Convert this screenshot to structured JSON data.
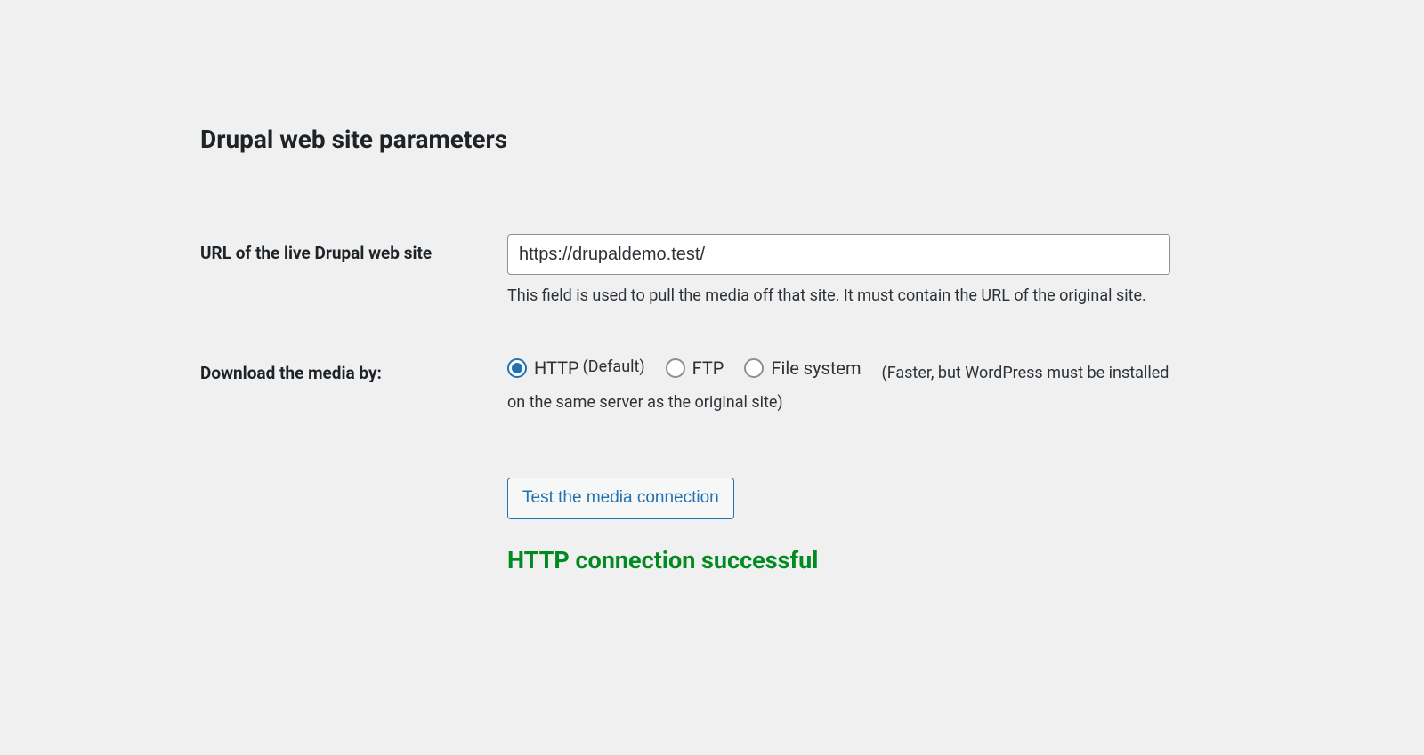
{
  "section": {
    "title": "Drupal web site parameters"
  },
  "url_field": {
    "label": "URL of the live Drupal web site",
    "value": "https://drupaldemo.test/",
    "description": "This field is used to pull the media off that site. It must contain the URL of the original site."
  },
  "download_media": {
    "label": "Download the media by:",
    "options": {
      "http": {
        "label": "HTTP",
        "suffix": "(Default)",
        "checked": true
      },
      "ftp": {
        "label": "FTP",
        "checked": false
      },
      "filesystem": {
        "label": "File system",
        "checked": false
      }
    },
    "trailing_note": "(Faster, but WordPress must be installed on the same server as the original site)"
  },
  "actions": {
    "test_connection_button": "Test the media connection"
  },
  "status": {
    "message": "HTTP connection successful"
  }
}
